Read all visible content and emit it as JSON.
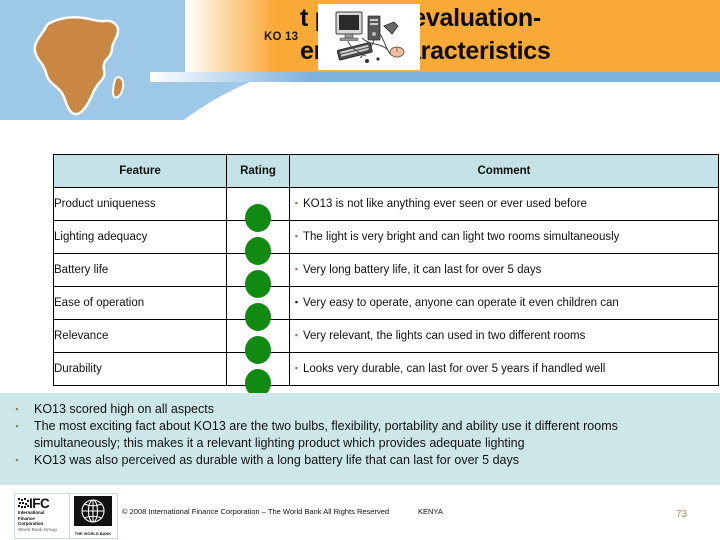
{
  "header": {
    "ko_label": "KO 13",
    "title_line1": "t product evaluation-",
    "title_line2": "eneral characteristics",
    "africa_map_name": "africa-map-graphic",
    "picture_name": "electronics-photo",
    "colors": {
      "orange": "#f9a936",
      "blue": "#9dc8e8",
      "blue_band": "#7fb2dd",
      "africa": "#c98743"
    }
  },
  "table": {
    "columns": [
      "Feature",
      "Rating",
      "Comment"
    ],
    "rating_color": "#108a10",
    "header_bg": "#c5e3e6",
    "rows": [
      {
        "feature": "Product uniqueness",
        "rating": "green",
        "bullet": "▪",
        "comment": "KO13 is not like anything ever seen or ever used before"
      },
      {
        "feature": "Lighting adequacy",
        "rating": "green",
        "bullet": "▪",
        "comment": "The light is very bright and can light two rooms simultaneously"
      },
      {
        "feature": "Battery life",
        "rating": "green",
        "bullet": "▪",
        "comment": "Very long battery life, it can last for over 5 days"
      },
      {
        "feature": "Ease of operation",
        "rating": "green",
        "bullet": "▪",
        "comment": "Very easy to operate, anyone can operate it even children can"
      },
      {
        "feature": "Relevance",
        "rating": "green",
        "bullet": "▪",
        "comment": " Very relevant, the lights can used in two different rooms"
      },
      {
        "feature": "Durability",
        "rating": "green",
        "bullet": "▪",
        "comment": "Looks very durable, can last for over 5 years if handled well"
      }
    ]
  },
  "summary": {
    "bg_color": "#cde7e9",
    "bullet": "▪",
    "items": [
      "KO13 scored high on all aspects",
      "The most exciting fact about KO13 are the two bulbs, flexibility, portability and ability use it different rooms simultaneously; this makes it a relevant lighting product which provides adequate lighting",
      "KO13 was also perceived as durable with a long battery life that can last for over 5 days"
    ]
  },
  "footer": {
    "ifc_word": "IFC",
    "ifc_sub_line1": "International",
    "ifc_sub_line2": "Finance",
    "ifc_sub_line3": "Corporation",
    "ifc_sub_line4": "World Bank Group",
    "worldbank_sub": "THE WORLD BANK",
    "copyright_main": "© 2008 International Finance Corporation – The World Bank All Rights Reserved",
    "copyright_overlay": "KENYA",
    "page_number": "73",
    "page_number_color": "#a39160"
  }
}
